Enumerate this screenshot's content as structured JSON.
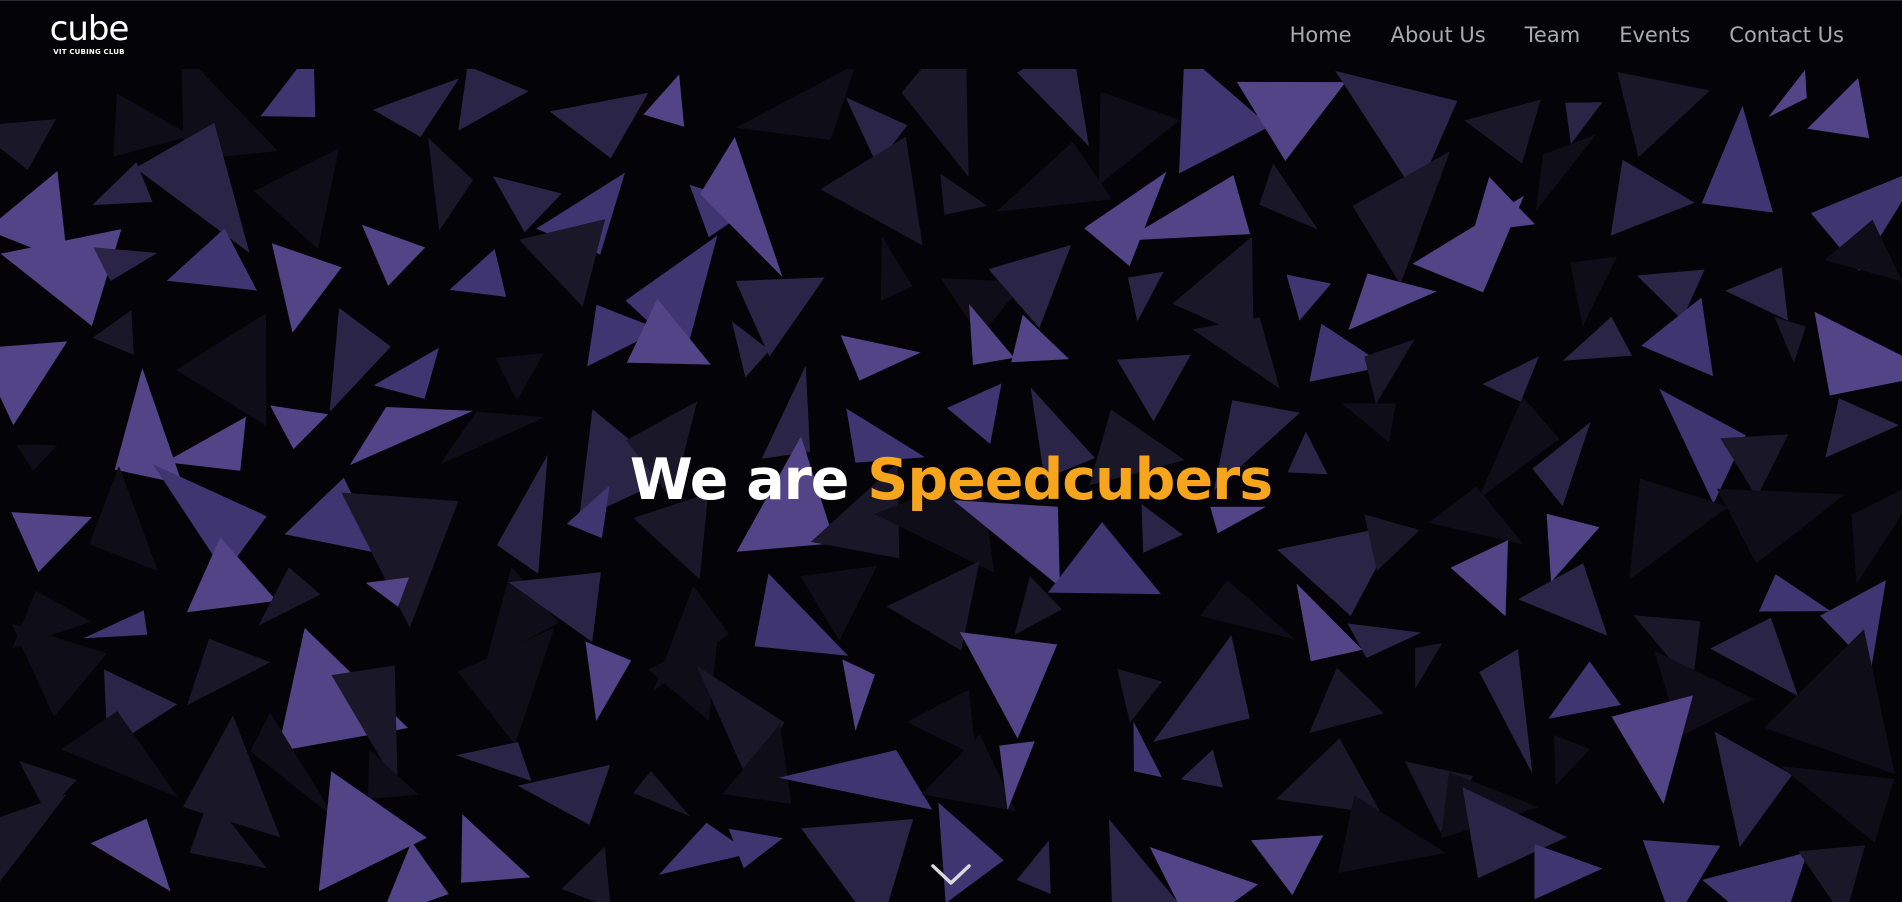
{
  "header": {
    "logo": {
      "word": "cube",
      "subtitle": "VIT CUBING CLUB"
    },
    "nav": [
      {
        "label": "Home"
      },
      {
        "label": "About Us"
      },
      {
        "label": "Team"
      },
      {
        "label": "Events"
      },
      {
        "label": "Contact Us"
      }
    ]
  },
  "hero": {
    "title_prefix": "We are",
    "title_accent": "Speedcubers",
    "accent_color": "#f6a51d",
    "scroll_icon": "chevron-down-icon"
  },
  "theme": {
    "background": "#040408",
    "triangle_colors": [
      "#514587",
      "#3f3571",
      "#2a2446",
      "#1a1729",
      "#0f0d18"
    ]
  }
}
